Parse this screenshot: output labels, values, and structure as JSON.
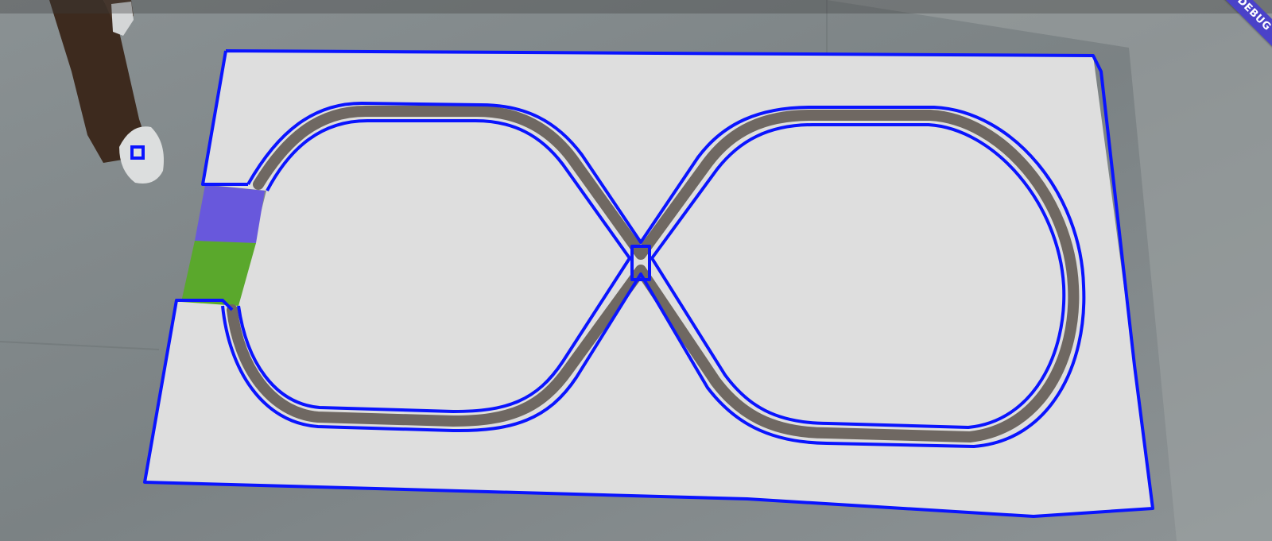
{
  "debug_banner": {
    "label": "DEBUG",
    "color": "#4a42c8"
  },
  "detection": {
    "outline_color": "#0a14ff",
    "track_color": "#6f6862",
    "mat_color": "#dedede",
    "zone_colors": {
      "upper": "#6858dc",
      "lower": "#5aa82c"
    }
  },
  "background": {
    "floor_color": "#7d8486",
    "light_floor_color": "#a0a5a5"
  }
}
